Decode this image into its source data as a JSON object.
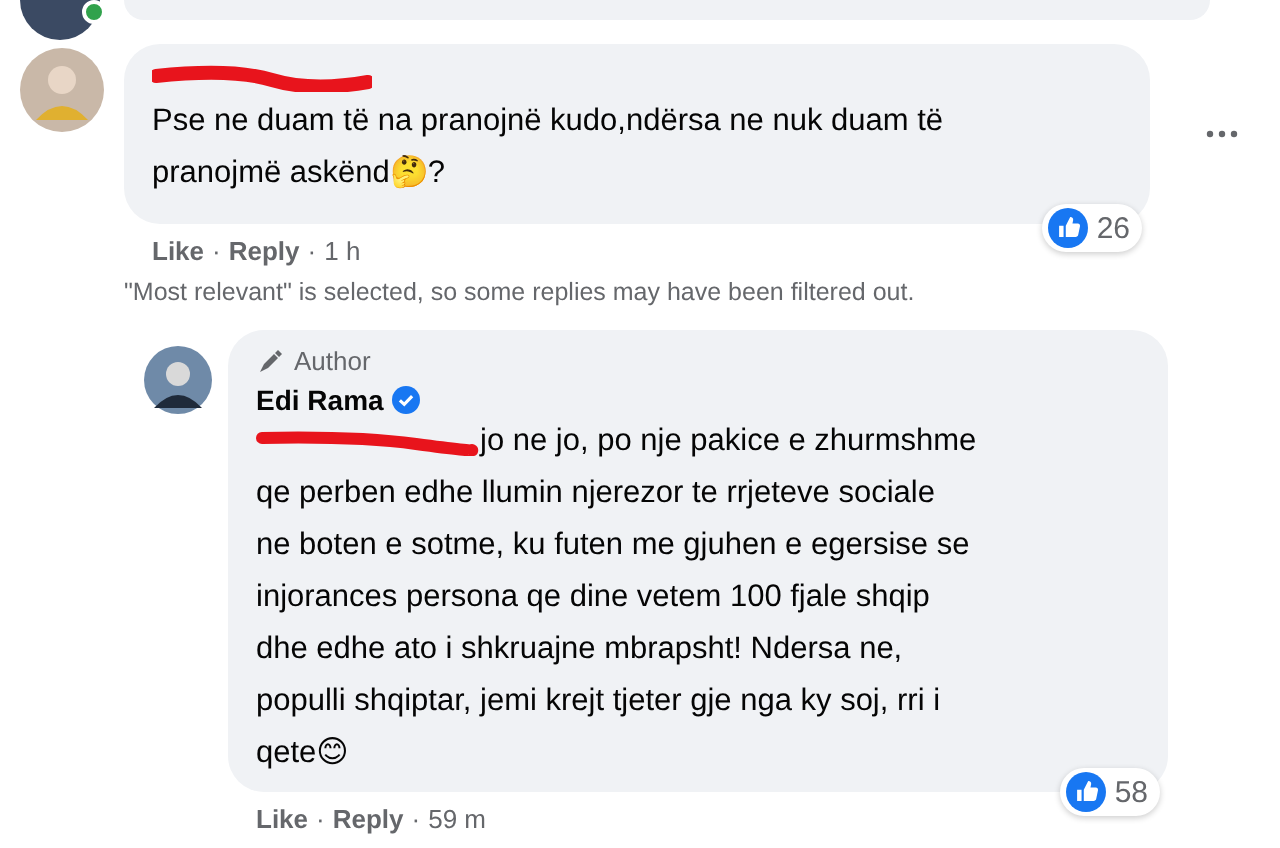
{
  "previous_comment": {
    "online": true
  },
  "comment": {
    "name_redacted": true,
    "lines": [
      "Pse ne duam të na pranojnë kudo,ndërsa ne nuk duam të",
      "pranojmë askënd🤔?"
    ],
    "reaction_count": "26",
    "actions": [
      "Like",
      "Reply"
    ],
    "separator": "·",
    "time": "1 h"
  },
  "filter_note": "\"Most relevant\" is selected, so some replies may have been filtered out.",
  "reply": {
    "badge": "Author",
    "name": "Edi Rama",
    "verified": true,
    "mention_redacted": true,
    "first_line": "jo ne jo, po nje pakice e zhurmshme",
    "lines": [
      "qe perben edhe llumin njerezor te rrjeteve sociale",
      "ne boten e sotme, ku futen me gjuhen e egersise se",
      "injorances persona qe dine vetem 100 fjale shqip",
      "dhe edhe ato i shkruajne mbrapsht! Ndersa ne,",
      "populli shqiptar, jemi krejt tjeter gje nga ky soj, rri i",
      "qete😊"
    ],
    "reaction_count": "58",
    "actions": [
      "Like",
      "Reply"
    ],
    "separator": "·",
    "time": "59 m"
  }
}
